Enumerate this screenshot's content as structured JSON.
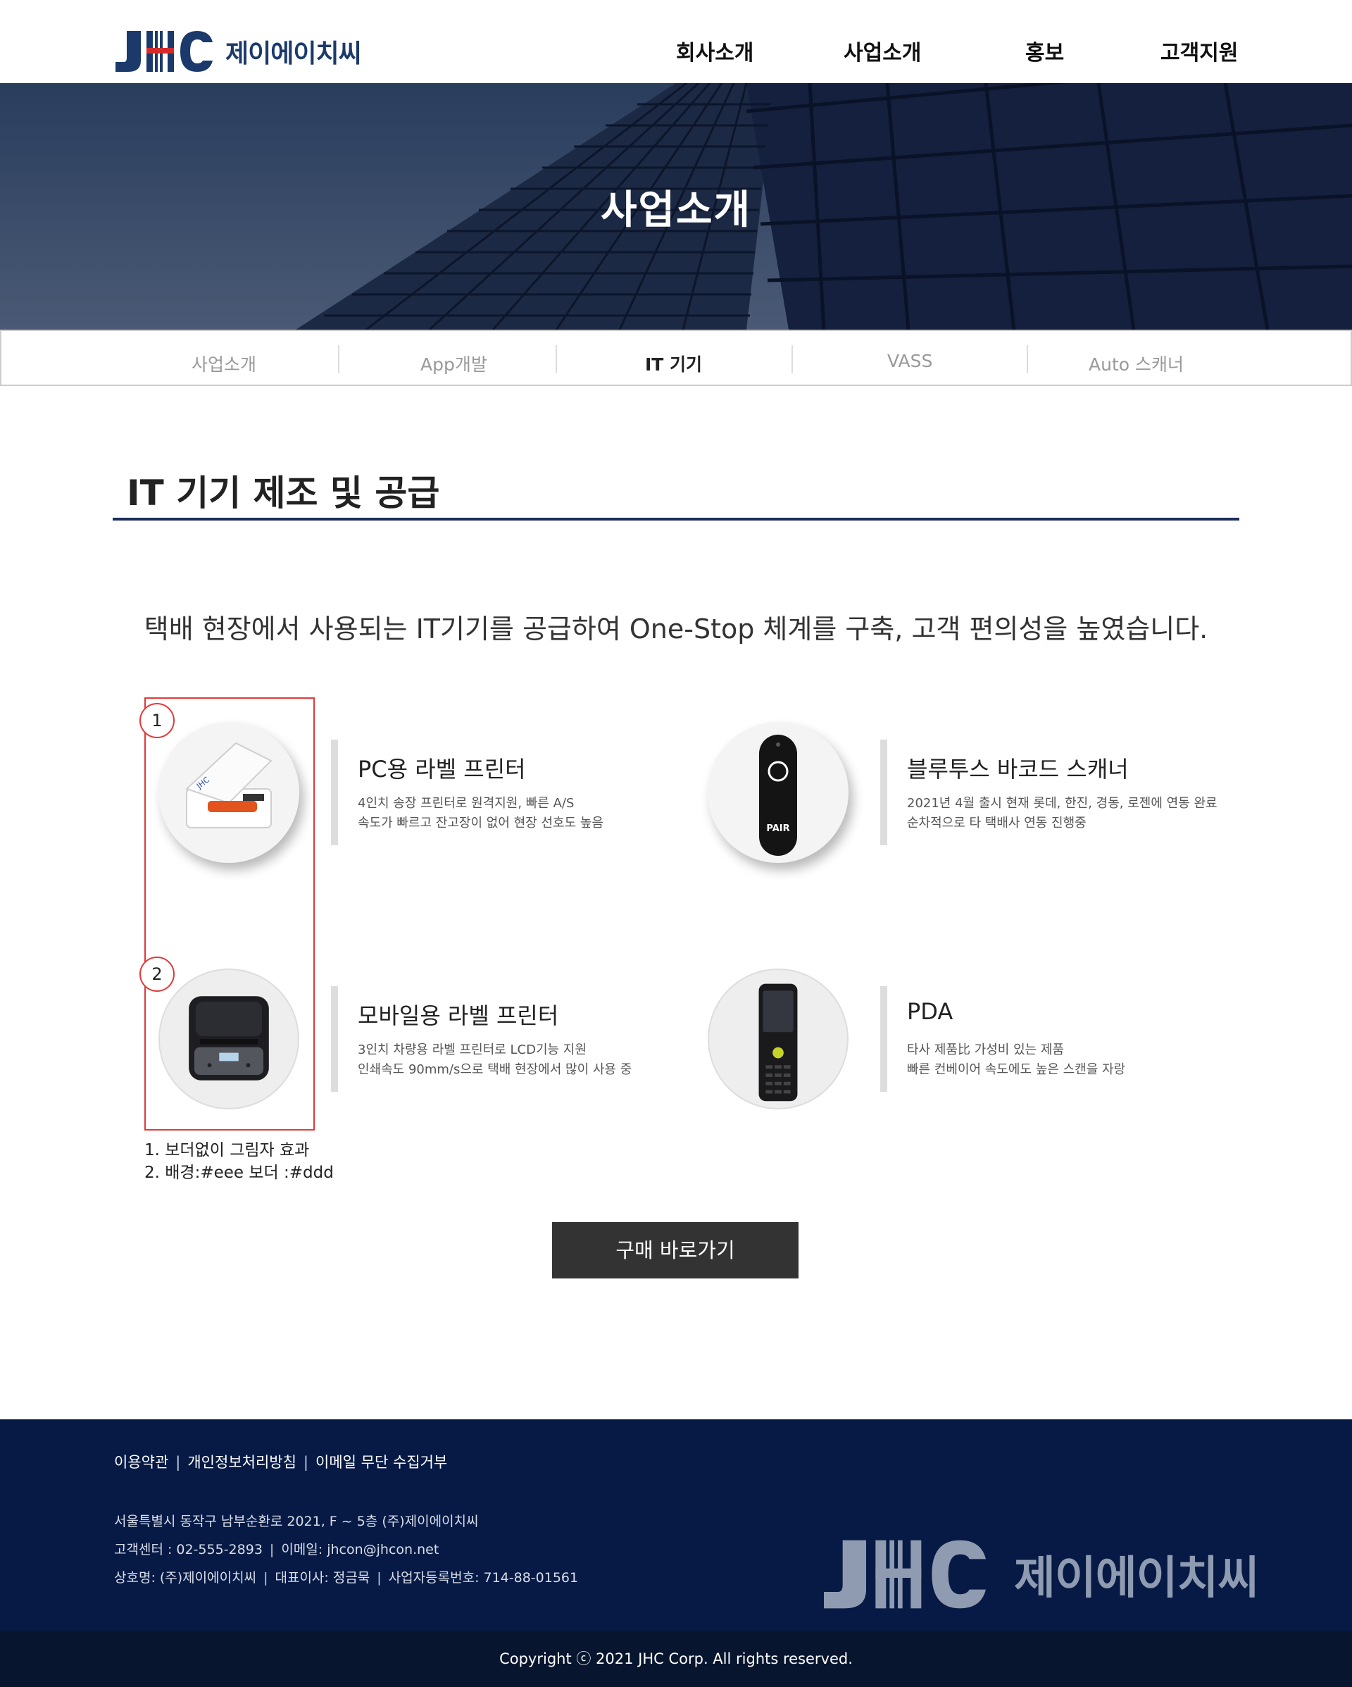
{
  "header": {
    "logo_text": "제이에이치씨",
    "logo_mark": "JHC",
    "nav": [
      "회사소개",
      "사업소개",
      "홍보",
      "고객지원"
    ],
    "brand_color": "#1b3a6b",
    "accent_color": "#d42b2b"
  },
  "banner": {
    "title": "사업소개"
  },
  "subnav": {
    "items": [
      "사업소개",
      "App개발",
      "IT 기기",
      "VASS",
      "Auto 스캐너"
    ],
    "active": "IT 기기"
  },
  "section": {
    "title": "IT 기기 제조 및 공급",
    "lead": "택배 현장에서 사용되는 IT기기를 공급하여 One-Stop 체계를 구축, 고객 편의성을 높였습니다."
  },
  "products": [
    {
      "name": "PC용 라벨 프린터",
      "desc": [
        "4인치 송장 프린터로 원격지원, 빠른 A/S",
        "속도가 빠르고 잔고장이 없어 현장 선호도 높음"
      ],
      "icon": "label-printer-icon"
    },
    {
      "name": "블루투스 바코드 스캐너",
      "desc": [
        "2021년 4월 출시 현재 롯데, 한진, 경동, 로젠에 연동 완료",
        "순차적으로 타 택배사 연동 진행중"
      ],
      "icon": "barcode-scanner-icon",
      "device_label": "PAIR"
    },
    {
      "name": "모바일용 라벨 프린터",
      "desc": [
        "3인치 차량용 라벨 프린터로 LCD기능 지원",
        "인쇄속도 90mm/s으로 택배 현장에서 많이 사용 중"
      ],
      "icon": "mobile-printer-icon"
    },
    {
      "name": "PDA",
      "desc": [
        "타사 제품比 가성비 있는 제품",
        "빠른 컨베이어 속도에도 높은 스캔을 자랑"
      ],
      "icon": "pda-icon"
    }
  ],
  "annotations": {
    "numbers": [
      "1",
      "2"
    ],
    "notes": [
      "1. 보더없이 그림자 효과",
      "2. 배경:#eee 보더 :#ddd"
    ],
    "color": "#e03a3a"
  },
  "buy_button": "구매 바로가기",
  "footer": {
    "links": [
      "이용약관",
      "개인정보처리방침",
      "이메일 무단 수집거부"
    ],
    "address": "서울특별시 동작구 남부순환로 2021, F ~ 5층 (주)제이에이치씨",
    "contact": [
      "고객센터 : 02-555-2893",
      "이메일: jhcon@jhcon.net"
    ],
    "company": [
      "상호명: (주)제이에이치씨",
      "대표이사: 정금묵",
      "사업자등록번호: 714-88-01561"
    ],
    "logo_text": "제이에이치씨",
    "copyright": "Copyright ⓒ 2021 JHC Corp. All rights reserved.",
    "bg_color": "#061a45"
  }
}
